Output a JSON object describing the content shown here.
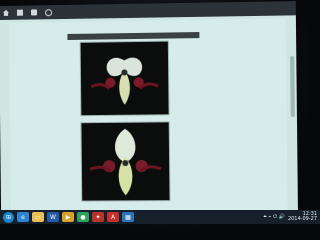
{
  "toolbar": {
    "items": [
      {
        "label": "",
        "icon": "home-icon"
      },
      {
        "label": "",
        "icon": "email-icon"
      },
      {
        "label": "",
        "icon": "print-icon"
      },
      {
        "label": "",
        "icon": "find-icon"
      }
    ],
    "zoom_label": ""
  },
  "document": {
    "header_text": "",
    "body_text": [
      "",
      "",
      "",
      "",
      "",
      ""
    ]
  },
  "taskbar": {
    "time": "12:31",
    "date": "2014-09-27"
  },
  "colors": {
    "screen_bg": "#cfe7e5",
    "page_bg": "#d5ecea",
    "taskbar_bg": "#16202b"
  }
}
